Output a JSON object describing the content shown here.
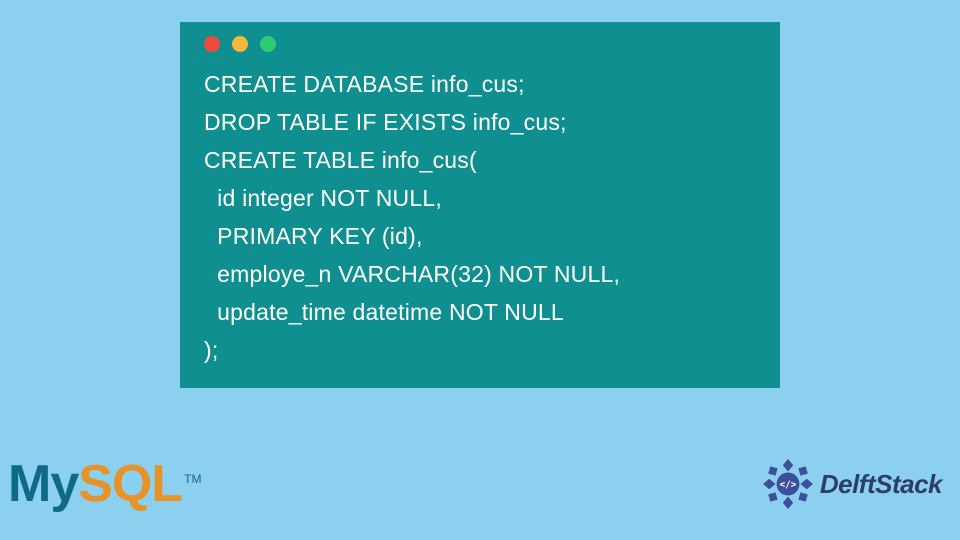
{
  "code": {
    "lines": [
      "CREATE DATABASE info_cus;",
      "DROP TABLE IF EXISTS info_cus;",
      "CREATE TABLE info_cus(",
      "  id integer NOT NULL,",
      "  PRIMARY KEY (id),",
      "  employe_n VARCHAR(32) NOT NULL,",
      "  update_time datetime NOT NULL",
      ");"
    ]
  },
  "traffic_lights": {
    "red": "#ef4a3e",
    "yellow": "#f6b93b",
    "green": "#2ecc71"
  },
  "logos": {
    "mysql": {
      "my": "My",
      "sql": "SQL",
      "tm": "TM"
    },
    "delftstack": {
      "text": "DelftStack",
      "badge_symbol": "</>"
    }
  },
  "colors": {
    "page_bg": "#8bd0ee",
    "code_bg": "#0f8f8f",
    "code_fg": "#ffffff",
    "mysql_my": "#0e6a87",
    "mysql_sql": "#e8922a",
    "delft_text": "#2d3e6b",
    "delft_badge": "#3b4f9b"
  }
}
